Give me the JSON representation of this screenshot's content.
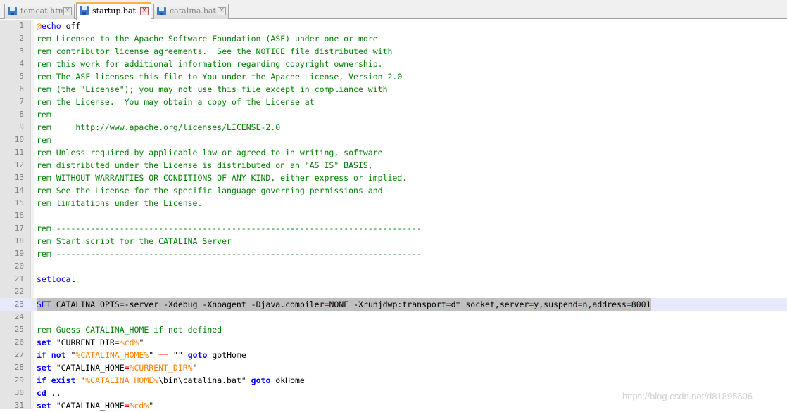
{
  "tabs": [
    {
      "label": "tomcat.html",
      "active": false
    },
    {
      "label": "startup.bat",
      "active": true
    },
    {
      "label": "catalina.bat",
      "active": false
    }
  ],
  "colors": {
    "active_tab_accent": "#fab24a",
    "comment": "#008000",
    "keyword": "#0000ff",
    "variable": "#ff8000",
    "operator": "#ff0000",
    "current_line": "#e8e8ff",
    "selection": "#c0c0c0"
  },
  "icons": {
    "tab_icon": "floppy-disk-icon",
    "tab_close": "close-icon"
  },
  "editor": {
    "lines": [
      {
        "n": "1",
        "tokens": [
          {
            "t": "@",
            "c": "at"
          },
          {
            "t": "echo",
            "c": "kwn"
          },
          {
            "t": " off",
            "c": "plain"
          }
        ]
      },
      {
        "n": "2",
        "tokens": [
          {
            "t": "rem Licensed to the Apache Software Foundation (ASF) under one or more",
            "c": "comment"
          }
        ]
      },
      {
        "n": "3",
        "tokens": [
          {
            "t": "rem contributor license agreements.  See the NOTICE file distributed with",
            "c": "comment"
          }
        ]
      },
      {
        "n": "4",
        "tokens": [
          {
            "t": "rem this work for additional information regarding copyright ownership.",
            "c": "comment"
          }
        ]
      },
      {
        "n": "5",
        "tokens": [
          {
            "t": "rem The ASF licenses this file to You under the Apache License, Version 2.0",
            "c": "comment"
          }
        ]
      },
      {
        "n": "6",
        "tokens": [
          {
            "t": "rem (the \"License\"); you may not use this file except in compliance with",
            "c": "comment"
          }
        ]
      },
      {
        "n": "7",
        "tokens": [
          {
            "t": "rem the License.  You may obtain a copy of the License at",
            "c": "comment"
          }
        ]
      },
      {
        "n": "8",
        "tokens": [
          {
            "t": "rem",
            "c": "comment"
          }
        ]
      },
      {
        "n": "9",
        "tokens": [
          {
            "t": "rem     ",
            "c": "comment"
          },
          {
            "t": "http://www.apache.org/licenses/LICENSE-2.0",
            "c": "link"
          }
        ]
      },
      {
        "n": "10",
        "tokens": [
          {
            "t": "rem",
            "c": "comment"
          }
        ]
      },
      {
        "n": "11",
        "tokens": [
          {
            "t": "rem Unless required by applicable law or agreed to in writing, software",
            "c": "comment"
          }
        ]
      },
      {
        "n": "12",
        "tokens": [
          {
            "t": "rem distributed under the License is distributed on an \"AS IS\" BASIS,",
            "c": "comment"
          }
        ]
      },
      {
        "n": "13",
        "tokens": [
          {
            "t": "rem WITHOUT WARRANTIES OR CONDITIONS OF ANY KIND, either express or implied.",
            "c": "comment"
          }
        ]
      },
      {
        "n": "14",
        "tokens": [
          {
            "t": "rem See the License for the specific language governing permissions and",
            "c": "comment"
          }
        ]
      },
      {
        "n": "15",
        "tokens": [
          {
            "t": "rem limitations under the License.",
            "c": "comment"
          }
        ]
      },
      {
        "n": "16",
        "tokens": []
      },
      {
        "n": "17",
        "tokens": [
          {
            "t": "rem ---------------------------------------------------------------------------",
            "c": "comment"
          }
        ]
      },
      {
        "n": "18",
        "tokens": [
          {
            "t": "rem Start script for the CATALINA Server",
            "c": "comment"
          }
        ]
      },
      {
        "n": "19",
        "tokens": [
          {
            "t": "rem ---------------------------------------------------------------------------",
            "c": "comment"
          }
        ]
      },
      {
        "n": "20",
        "tokens": []
      },
      {
        "n": "21",
        "tokens": [
          {
            "t": "setlocal",
            "c": "kwn"
          }
        ]
      },
      {
        "n": "22",
        "tokens": []
      },
      {
        "n": "23",
        "current": true,
        "selected": true,
        "tokens": [
          {
            "t": "SET",
            "c": "kwn"
          },
          {
            "t": " CATALINA_OPTS",
            "c": "plain"
          },
          {
            "t": "=",
            "c": "op"
          },
          {
            "t": "-server -Xdebug -Xnoagent -Djava.compiler",
            "c": "plain"
          },
          {
            "t": "=",
            "c": "op"
          },
          {
            "t": "NONE -Xrunjdwp:transport",
            "c": "plain"
          },
          {
            "t": "=",
            "c": "op"
          },
          {
            "t": "dt_socket,server",
            "c": "plain"
          },
          {
            "t": "=",
            "c": "op"
          },
          {
            "t": "y,suspend",
            "c": "plain"
          },
          {
            "t": "=",
            "c": "op"
          },
          {
            "t": "n,address",
            "c": "plain"
          },
          {
            "t": "=",
            "c": "op"
          },
          {
            "t": "8001",
            "c": "plain"
          }
        ]
      },
      {
        "n": "24",
        "tokens": []
      },
      {
        "n": "25",
        "tokens": [
          {
            "t": "rem Guess CATALINA_HOME if not defined",
            "c": "comment"
          }
        ]
      },
      {
        "n": "26",
        "tokens": [
          {
            "t": "set",
            "c": "kw"
          },
          {
            "t": " \"CURRENT_DIR",
            "c": "plain"
          },
          {
            "t": "=",
            "c": "op"
          },
          {
            "t": "%cd%",
            "c": "var"
          },
          {
            "t": "\"",
            "c": "plain"
          }
        ]
      },
      {
        "n": "27",
        "tokens": [
          {
            "t": "if not",
            "c": "kw"
          },
          {
            "t": " \"",
            "c": "plain"
          },
          {
            "t": "%CATALINA_HOME%",
            "c": "var"
          },
          {
            "t": "\" ",
            "c": "plain"
          },
          {
            "t": "==",
            "c": "op"
          },
          {
            "t": " \"\" ",
            "c": "plain"
          },
          {
            "t": "goto",
            "c": "kw"
          },
          {
            "t": " gotHome",
            "c": "plain"
          }
        ]
      },
      {
        "n": "28",
        "tokens": [
          {
            "t": "set",
            "c": "kw"
          },
          {
            "t": " \"CATALINA_HOME",
            "c": "plain"
          },
          {
            "t": "=",
            "c": "op"
          },
          {
            "t": "%CURRENT_DIR%",
            "c": "var"
          },
          {
            "t": "\"",
            "c": "plain"
          }
        ]
      },
      {
        "n": "29",
        "tokens": [
          {
            "t": "if exist",
            "c": "kw"
          },
          {
            "t": " \"",
            "c": "plain"
          },
          {
            "t": "%CATALINA_HOME%",
            "c": "var"
          },
          {
            "t": "\\bin\\catalina.bat\" ",
            "c": "plain"
          },
          {
            "t": "goto",
            "c": "kw"
          },
          {
            "t": " okHome",
            "c": "plain"
          }
        ]
      },
      {
        "n": "30",
        "tokens": [
          {
            "t": "cd",
            "c": "kw"
          },
          {
            "t": " ..",
            "c": "plain"
          }
        ]
      },
      {
        "n": "31",
        "tokens": [
          {
            "t": "set",
            "c": "kw"
          },
          {
            "t": " \"CATALINA_HOME",
            "c": "plain"
          },
          {
            "t": "=",
            "c": "op"
          },
          {
            "t": "%cd%",
            "c": "var"
          },
          {
            "t": "\"",
            "c": "plain"
          }
        ]
      }
    ]
  },
  "watermark": "https://blog.csdn.net/d81895606"
}
